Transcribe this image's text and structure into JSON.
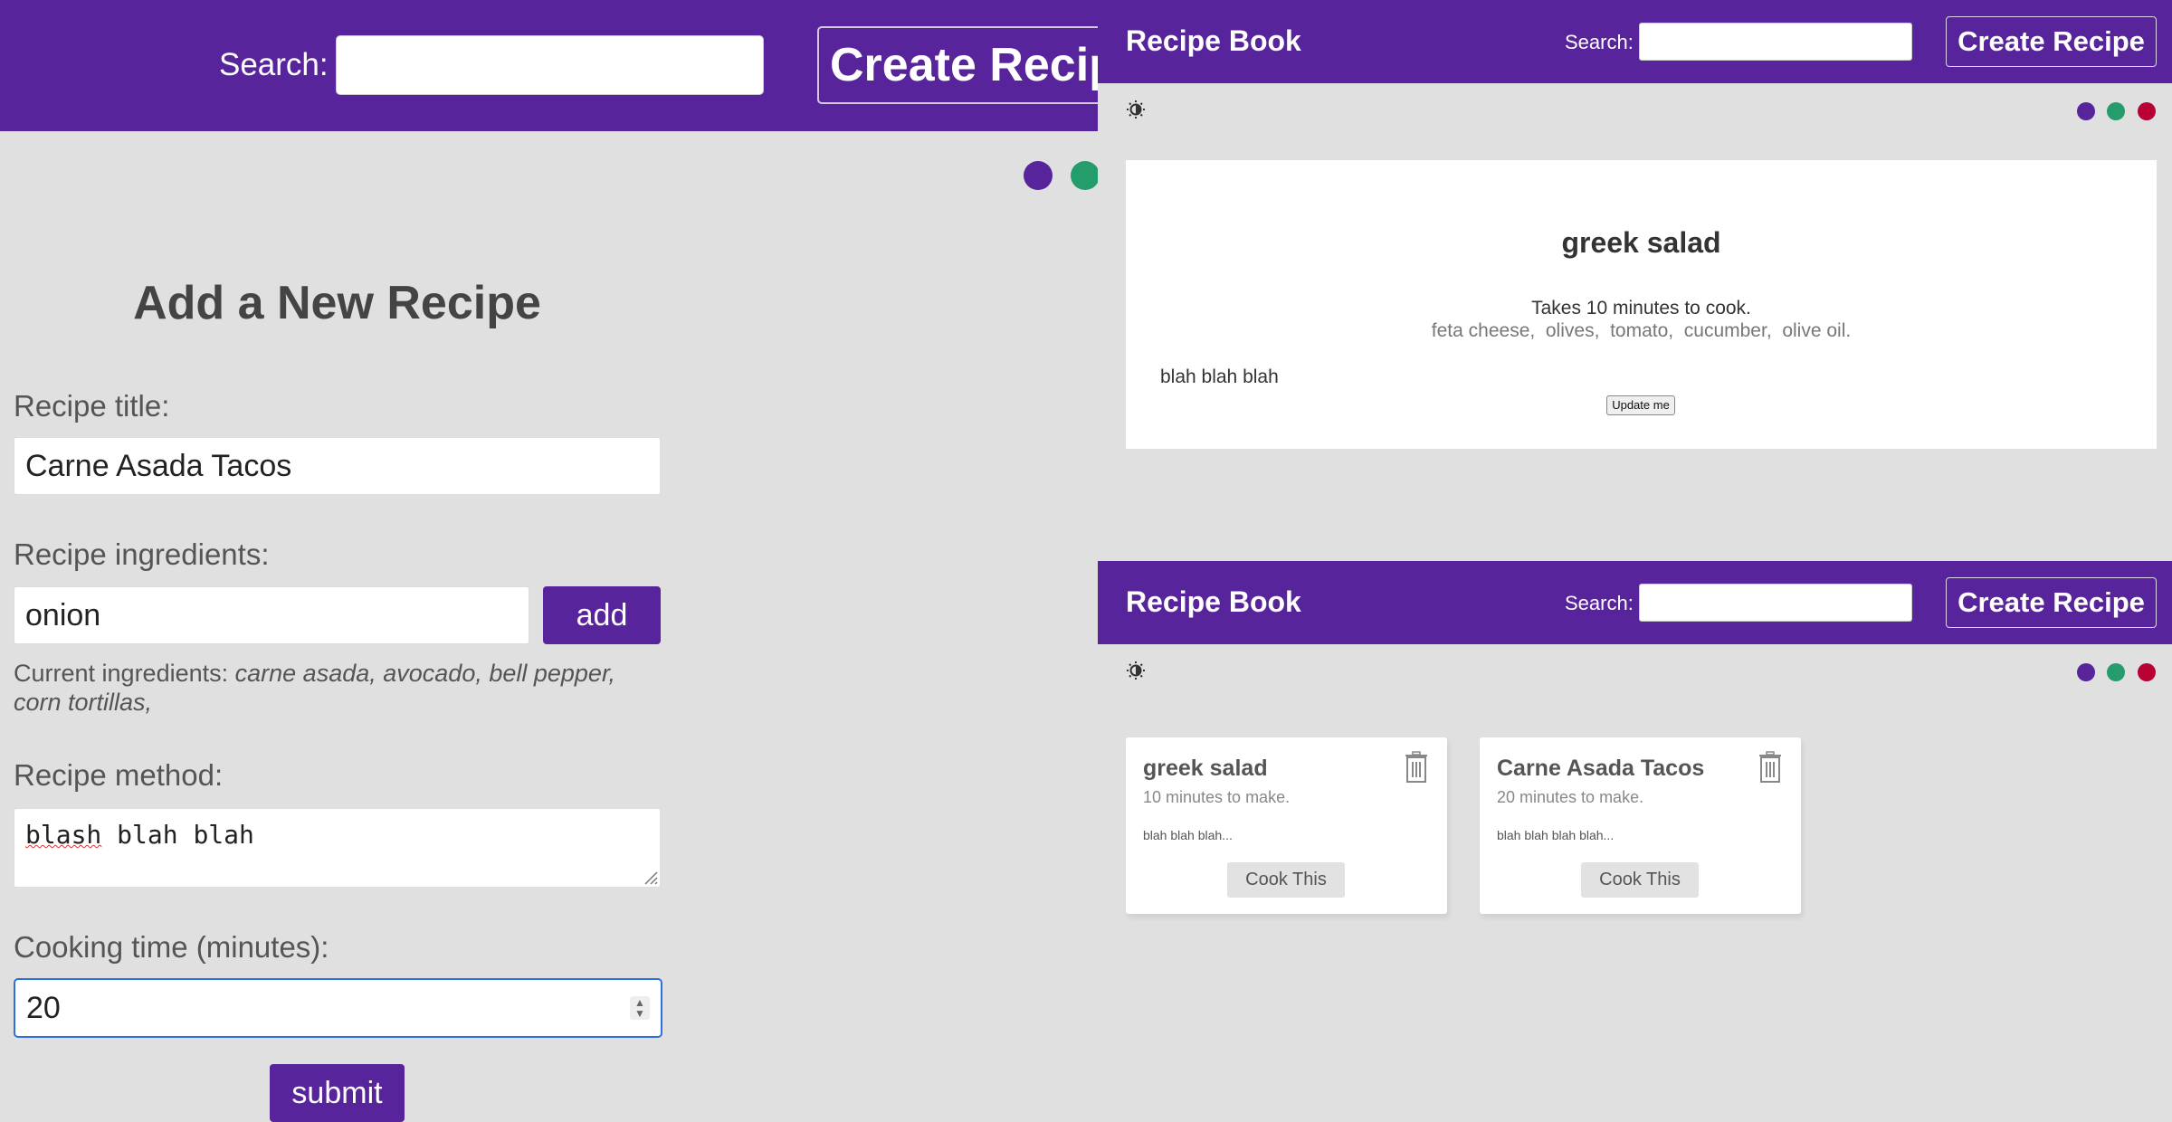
{
  "colors": {
    "brand": "#58249c",
    "mode_purple": "#58249c",
    "mode_green": "#249c6b",
    "mode_red": "#b70233",
    "background": "#e0e0e0"
  },
  "create_page": {
    "navbar": {
      "search_label": "Search:",
      "search_value": "",
      "create_button": "Create Recipe"
    },
    "form": {
      "heading": "Add a New Recipe",
      "title_label": "Recipe title:",
      "title_value": "Carne Asada Tacos",
      "ingredients_label": "Recipe ingredients:",
      "ingredient_value": "onion",
      "add_button": "add",
      "current_ingredients_label": "Current ingredients:",
      "current_ingredients": "carne asada, avocado, bell pepper, corn tortillas,",
      "method_label": "Recipe method:",
      "method_misspelled": "blash",
      "method_rest": " blah blah",
      "time_label": "Cooking time (minutes):",
      "time_value": "20",
      "submit_button": "submit"
    }
  },
  "recipe_page": {
    "navbar": {
      "brand": "Recipe Book",
      "search_label": "Search:",
      "create_button": "Create Recipe"
    },
    "recipe": {
      "title": "greek salad",
      "time": "Takes 10 minutes to cook.",
      "ingredients": "feta cheese,  olives,  tomato,  cucumber,  olive oil.",
      "method": "blah blah blah",
      "update_button": "Update me"
    }
  },
  "home_page": {
    "navbar": {
      "brand": "Recipe Book",
      "search_label": "Search:",
      "create_button": "Create Recipe"
    },
    "cards": [
      {
        "title": "greek salad",
        "time": "10 minutes to make.",
        "method": "blah blah blah...",
        "cook_button": "Cook This"
      },
      {
        "title": "Carne Asada Tacos",
        "time": "20 minutes to make.",
        "method": "blah blah blah blah...",
        "cook_button": "Cook This"
      }
    ]
  },
  "icons": [
    "brightness-icon",
    "trash-icon",
    "resize-grip-icon",
    "spinner-arrows-icon"
  ]
}
